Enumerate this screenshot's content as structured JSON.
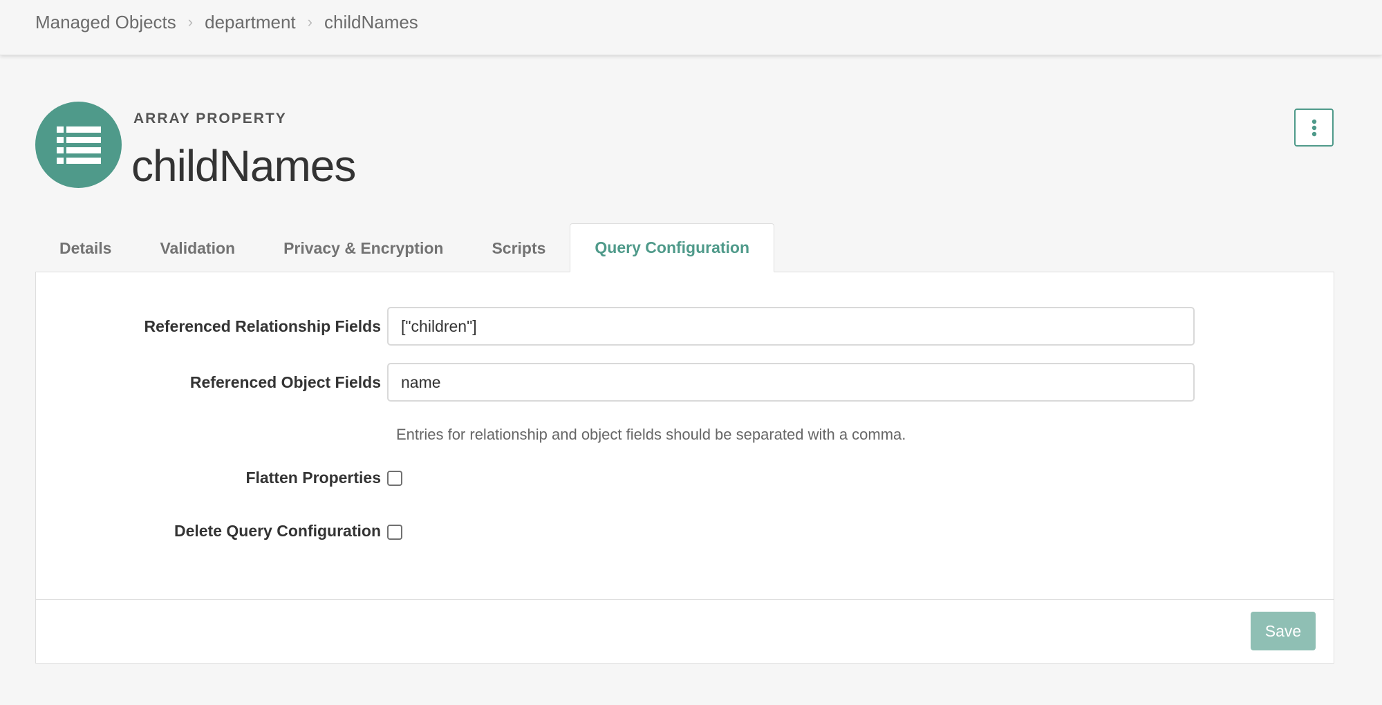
{
  "breadcrumb": [
    {
      "label": "Managed Objects"
    },
    {
      "label": "department"
    },
    {
      "label": "childNames"
    }
  ],
  "header": {
    "eyebrow": "ARRAY PROPERTY",
    "title": "childNames",
    "icon": "list-icon",
    "accent_color": "#4f9a8a"
  },
  "tabs": [
    {
      "label": "Details",
      "active": false
    },
    {
      "label": "Validation",
      "active": false
    },
    {
      "label": "Privacy & Encryption",
      "active": false
    },
    {
      "label": "Scripts",
      "active": false
    },
    {
      "label": "Query Configuration",
      "active": true
    }
  ],
  "form": {
    "relationship_fields": {
      "label": "Referenced Relationship Fields",
      "value": "[\"children\"]"
    },
    "object_fields": {
      "label": "Referenced Object Fields",
      "value": "name"
    },
    "help_text": "Entries for relationship and object fields should be separated with a comma.",
    "flatten_properties": {
      "label": "Flatten Properties",
      "checked": false
    },
    "delete_query_config": {
      "label": "Delete Query Configuration",
      "checked": false
    }
  },
  "footer": {
    "save_label": "Save"
  }
}
